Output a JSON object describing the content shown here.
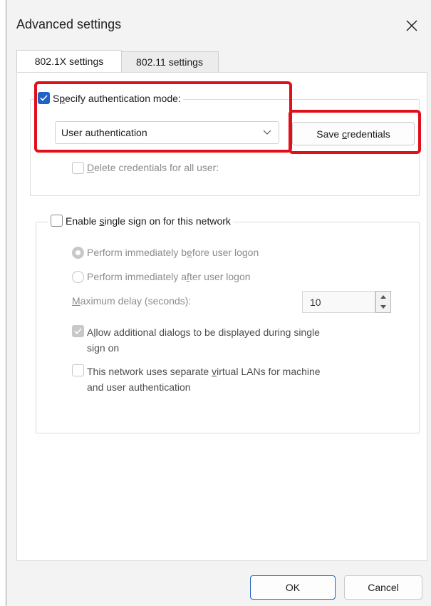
{
  "window": {
    "title": "Advanced settings",
    "close_icon": "close-icon"
  },
  "tabs": [
    {
      "label": "802.1X settings",
      "active": true
    },
    {
      "label": "802.11 settings",
      "active": false
    }
  ],
  "auth_group": {
    "specify_auth": {
      "pre": "S",
      "key": "p",
      "post": "ecify authentication mode:",
      "checked": true
    },
    "mode_select": {
      "value": "User authentication"
    },
    "save_button": {
      "pre": "Save ",
      "key": "c",
      "post": "redentials"
    },
    "delete_creds": {
      "pre": "",
      "key": "D",
      "post": "elete credentials for all user:",
      "checked": false,
      "disabled": true
    }
  },
  "sso_group": {
    "enable_sso": {
      "pre": "Enable ",
      "key": "s",
      "post": "ingle sign on for this network",
      "checked": false
    },
    "before_logon": {
      "pre": "Perform immediately b",
      "key": "e",
      "post": "fore user logon",
      "selected": true,
      "disabled": true
    },
    "after_logon": {
      "pre": "Perform immediately a",
      "key": "f",
      "post": "ter user logon",
      "selected": false,
      "disabled": true
    },
    "max_delay": {
      "pre": "",
      "key": "M",
      "post": "aximum delay (seconds):",
      "value": "10"
    },
    "allow_dialogs": {
      "pre": "A",
      "key": "l",
      "post": "low additional dialogs to be displayed during single",
      "line2": "sign on",
      "checked": true,
      "disabled": true
    },
    "separate_vlans": {
      "pre": "This network uses separate ",
      "key": "v",
      "post": "irtual LANs for machine",
      "line2": "and user authentication",
      "checked": false,
      "disabled": true
    }
  },
  "footer": {
    "ok_label": "OK",
    "cancel_label": "Cancel"
  },
  "colors": {
    "accent": "#1e63c8",
    "highlight": "#e0101a",
    "disabled_text": "#8c8c8c"
  }
}
